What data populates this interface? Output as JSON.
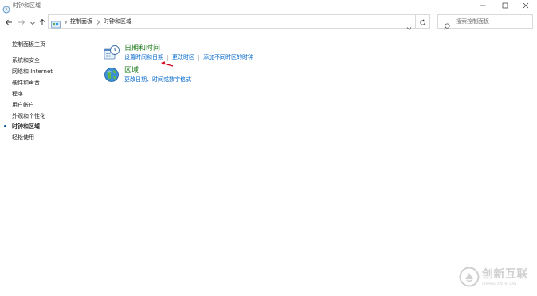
{
  "window": {
    "title": "时钟和区域",
    "controls": {
      "minimize": "minimize-icon",
      "maximize": "maximize-icon",
      "close": "close-icon"
    }
  },
  "navigation": {
    "back": "back-arrow-icon",
    "forward": "forward-arrow-icon",
    "recent": "chevron-down-icon",
    "up": "up-arrow-icon"
  },
  "address": {
    "breadcrumbs": [
      "控制面板",
      "时钟和区域"
    ],
    "refresh": "refresh-icon"
  },
  "search": {
    "placeholder": "搜索控制面板"
  },
  "sidebar": {
    "home": "控制面板主页",
    "items": [
      {
        "label": "系统和安全"
      },
      {
        "label": "网络和 Internet"
      },
      {
        "label": "硬件和声音"
      },
      {
        "label": "程序"
      },
      {
        "label": "用户帐户"
      },
      {
        "label": "外观和个性化"
      },
      {
        "label": "时钟和区域",
        "current": true
      },
      {
        "label": "轻松使用"
      }
    ]
  },
  "main": {
    "sections": [
      {
        "title": "日期和时间",
        "icon": "clock-calendar-icon",
        "links": [
          "设置时间和日期",
          "更改时区",
          "添加不同时区的时钟"
        ]
      },
      {
        "title": "区域",
        "icon": "globe-icon",
        "links": [
          "更改日期、时间或数字格式"
        ]
      }
    ]
  },
  "annotation": {
    "icon": "red-arrow-icon",
    "color": "#d0021b"
  },
  "watermark": {
    "text": "创新互联",
    "sub": "CHUANG XIN HU LIAN",
    "color": "#d0d0d0"
  },
  "colors": {
    "heading": "#1e7b1e",
    "link": "#0066cc",
    "text": "#1f1f1f",
    "border": "#d9d9d9"
  }
}
